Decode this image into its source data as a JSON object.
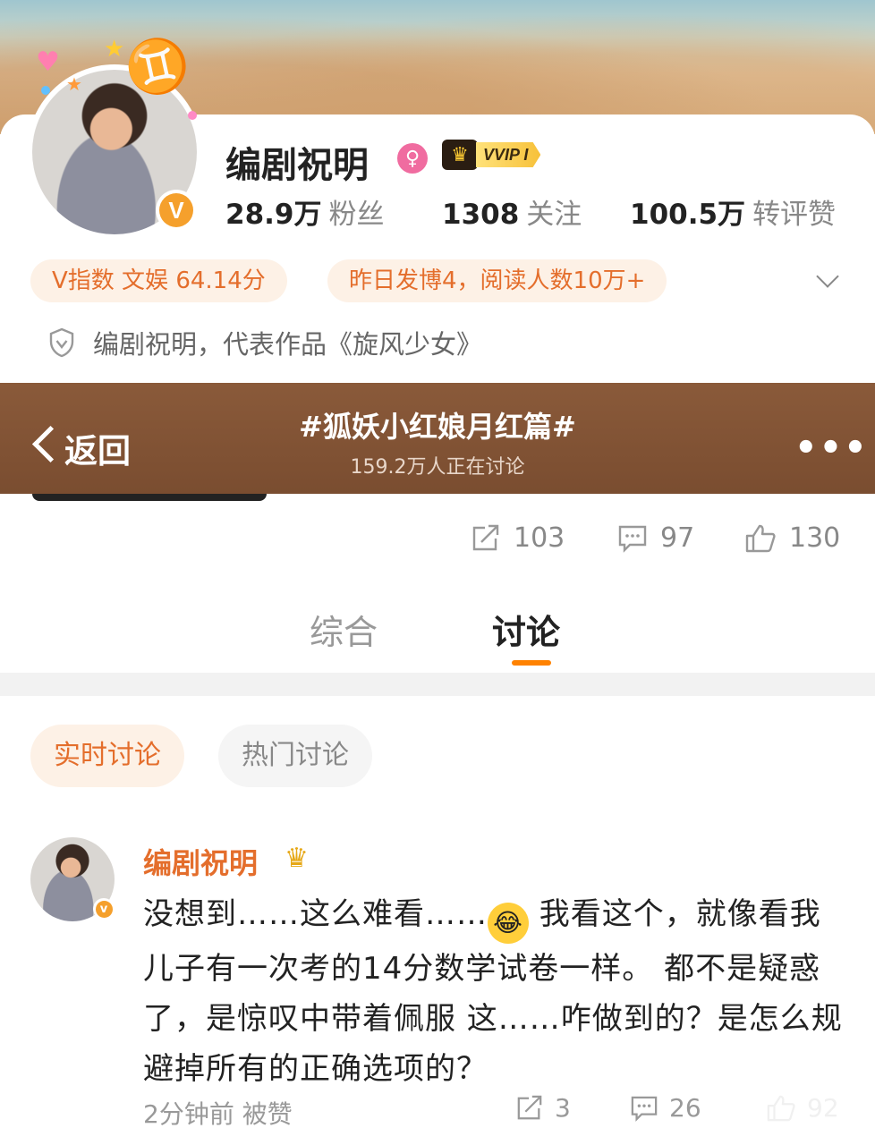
{
  "profile": {
    "name": "编剧祝明",
    "vip_label": "VVIP I",
    "stats": [
      {
        "value": "28.9万",
        "label": "粉丝"
      },
      {
        "value": "1308",
        "label": "关注"
      },
      {
        "value": "100.5万",
        "label": "转评赞"
      }
    ],
    "pills": [
      "V指数 文娱 64.14分",
      "昨日发博4，阅读人数10万+"
    ],
    "intro": "编剧祝明，代表作品《旋风少女》"
  },
  "navbar": {
    "back_label": "返回",
    "topic_title": "#狐妖小红娘月红篇#",
    "topic_subtitle": "159.2万人正在讨论"
  },
  "actions": {
    "repost": "103",
    "comment": "97",
    "like": "130"
  },
  "tabs": {
    "overview": "综合",
    "discussion": "讨论"
  },
  "filters": {
    "realtime": "实时讨论",
    "hot": "热门讨论"
  },
  "post": {
    "author": "编剧祝明",
    "text_part1": "没想到……这么难看……",
    "text_part2": " 我看这个，就像看我儿子有一次考的14分数学试卷一样。 都不是疑惑了，是惊叹中带着佩服 这……咋做到的？是怎么规避掉所有的正确选项的？",
    "meta": "2分钟前 被赞",
    "repost_count": "3",
    "comment_count": "26",
    "like_count": "92"
  },
  "colors": {
    "accent": "#ff8200",
    "accent_text": "#e46e2c",
    "navbar": "#7a4d30",
    "pill_bg": "#fdf1e6"
  }
}
